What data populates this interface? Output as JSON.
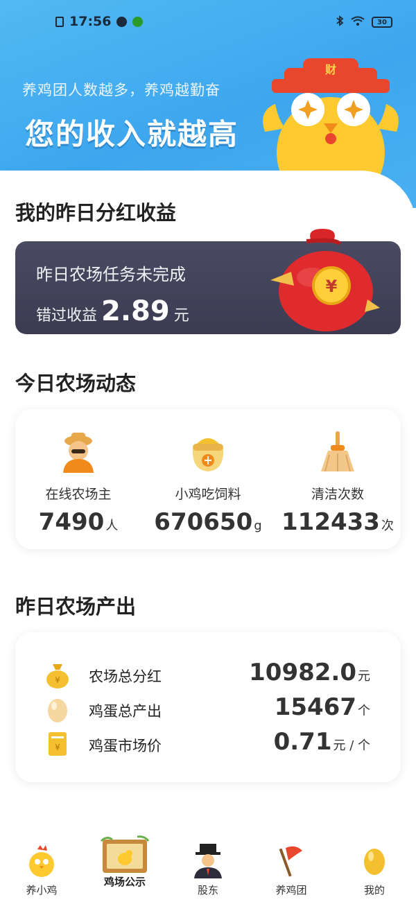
{
  "status_bar": {
    "time": "17:56",
    "battery": "30"
  },
  "hero": {
    "subtitle": "养鸡团人数越多，养鸡越勤奋",
    "title": "您的收入就越高",
    "hat_text": "财"
  },
  "yesterday_bonus": {
    "section_title": "我的昨日分红收益",
    "line1": "昨日农场任务未完成",
    "missed_label": "错过收益",
    "missed_amount": "2.89",
    "missed_unit": "元",
    "bag_symbol": "¥"
  },
  "today_farm": {
    "section_title": "今日农场动态",
    "stats": [
      {
        "label": "在线农场主",
        "value": "7490",
        "unit": "人"
      },
      {
        "label": "小鸡吃饲料",
        "value": "670650",
        "unit": "g"
      },
      {
        "label": "清洁次数",
        "value": "112433",
        "unit": "次"
      }
    ]
  },
  "yesterday_output": {
    "section_title": "昨日农场产出",
    "rows": [
      {
        "label": "农场总分红",
        "value": "10982.0",
        "unit": "元"
      },
      {
        "label": "鸡蛋总产出",
        "value": "15467",
        "unit": "个"
      },
      {
        "label": "鸡蛋市场价",
        "value": "0.71",
        "unit": "元 / 个"
      }
    ]
  },
  "tabbar": {
    "tabs": [
      {
        "label": "养小鸡"
      },
      {
        "label": "鸡场公示"
      },
      {
        "label": "股东"
      },
      {
        "label": "养鸡团"
      },
      {
        "label": "我的"
      }
    ],
    "active_index": 1
  },
  "colors": {
    "accent_blue": "#3ea6ee",
    "gold": "#f5b822",
    "dark_card": "#3b3b52"
  }
}
